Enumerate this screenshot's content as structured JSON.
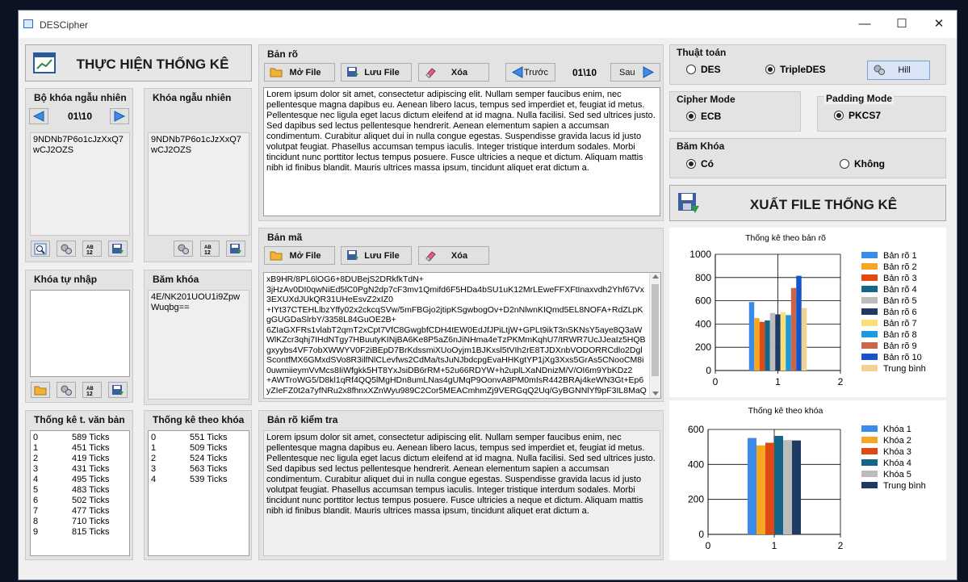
{
  "window": {
    "title": "DESCipher",
    "minimize": "—",
    "maximize": "☐",
    "close": "✕"
  },
  "stats_button": "THỰC HIỆN THỐNG KÊ",
  "random_key_set": {
    "title": "Bộ khóa ngẫu nhiên",
    "counter": "01\\10",
    "value": "9NDNb7P6o1cJzXxQ7wCJ2OZS"
  },
  "random_key": {
    "title": "Khóa ngẫu nhiên",
    "value": "9NDNb7P6o1cJzXxQ7wCJ2OZS"
  },
  "manual_key": {
    "title": "Khóa tự nhập",
    "value": ""
  },
  "hash_key": {
    "title": "Băm khóa",
    "value": "4E/NK201UOU1i9ZpwWuqbg=="
  },
  "plaintext": {
    "title": "Bản rõ",
    "open": "Mở File",
    "save": "Lưu File",
    "clear": "Xóa",
    "prev": "Trước",
    "counter": "01\\10",
    "next": "Sau",
    "text": "Lorem ipsum dolor sit amet, consectetur adipiscing elit. Nullam semper faucibus enim, nec pellentesque magna dapibus eu. Aenean libero lacus, tempus sed imperdiet et, feugiat id metus. Pellentesque nec ligula eget lacus dictum eleifend at id magna. Nulla facilisi. Sed sed ultrices justo. Sed dapibus sed lectus pellentesque hendrerit. Aenean elementum sapien a accumsan condimentum. Curabitur aliquet dui in nulla congue egestas. Suspendisse gravida lacus id justo volutpat feugiat. Phasellus accumsan tempus iaculis. Integer tristique interdum sodales. Morbi tincidunt nunc porttitor lectus tempus posuere. Fusce ultricies a neque et dictum. Aliquam mattis nibh id finibus blandit. Mauris ultrices massa ipsum, tincidunt aliquet erat dictum a."
  },
  "ciphertext": {
    "title": "Bản mã",
    "open": "Mở File",
    "save": "Lưu File",
    "clear": "Xóa",
    "text": "xB9HR/8PL6lOG6+8DUBejS2DRkfkTdN+\n3jHzAv0DI0qwNiEd5lC0PgN2dp7cF3mv1Qmifd6F5HDa4bSU1uK12MrLEweFFXFtInaxvdh2Yhf67Vx3EXUXdJUkQR31UHeEsvZ2xIZ0\n+IYt37CTEHLlbzYffy02x2ckcqSVw/5mFBGjo2jtipKSgwbogOv+D2nNlwnKIQmd5EL8NOFA+RdZLpKgGUGDaSlrbY/3358L84GuOE2B+\n6ZIaGXFRs1vlabT2qmT2xCpt7VfC8GwgbfCDH4tEW0EdJfJPiLtjW+GPLt9ikT3nSKNsY5aye8Q3aWWlKZcr3qhj7IHdNTgy7HBuutyKINjBA6Ke8P5aZ6nJiNHma4eTzPKMmKqhU7/tRWR7UcJJeaIz5HQBgxyybs4VF7obXWWYV0F2iBEpD7BrKdssmiXUoOyjm1BJKxsl5tVIh2rE8TJDXnbVODORRCdlo2DglScontfMX6GMxdSVo8R3ilfNlCLevfws2CdMa/tsJuNJbdcpgEvaHHKgtYP1jXg3Xxs5GrAs5CNooCM8i0uwmiieymVvMcs8IiWfgkk5HT8YxJsiDB6rRM+52u66RDYW+h2uplLXaNDnizM/V/OI6m9YbKDz2\n+AWTroWG5/D8kl1qRf4QQ5lMgHDn8umLNas4gUMqP9OonvA8PM0mIsR442BRAj4keWN3Gt+Ep6yZIeFZ0t2a7yfNRu2x8fhnxXZnWyu989C2Cor5MEACmhmZj9VERGqQ2Uq/GyBGNNlYf9pF3IL8MaQe"
  },
  "check_plaintext": {
    "title": "Bản rõ kiểm tra",
    "text": "Lorem ipsum dolor sit amet, consectetur adipiscing elit. Nullam semper faucibus enim, nec pellentesque magna dapibus eu. Aenean libero lacus, tempus sed imperdiet et, feugiat id metus. Pellentesque nec ligula eget lacus dictum eleifend at id magna. Nulla facilisi. Sed sed ultrices justo. Sed dapibus sed lectus pellentesque hendrerit. Aenean elementum sapien a accumsan condimentum. Curabitur aliquet dui in nulla congue egestas. Suspendisse gravida lacus id justo volutpat feugiat. Phasellus accumsan tempus iaculis. Integer tristique interdum sodales. Morbi tincidunt nunc porttitor lectus tempus posuere. Fusce ultricies a neque et dictum. Aliquam mattis nibh id finibus blandit. Mauris ultrices massa ipsum, tincidunt aliquet erat dictum a."
  },
  "text_stats": {
    "title": "Thống kê t. văn bản",
    "rows": [
      [
        "0",
        "589 Ticks"
      ],
      [
        "1",
        "451 Ticks"
      ],
      [
        "2",
        "419 Ticks"
      ],
      [
        "3",
        "431 Ticks"
      ],
      [
        "4",
        "495 Ticks"
      ],
      [
        "5",
        "483 Ticks"
      ],
      [
        "6",
        "502 Ticks"
      ],
      [
        "7",
        "477 Ticks"
      ],
      [
        "8",
        "710 Ticks"
      ],
      [
        "9",
        "815 Ticks"
      ]
    ]
  },
  "key_stats": {
    "title": "Thống kê theo khóa",
    "rows": [
      [
        "0",
        "551 Ticks"
      ],
      [
        "1",
        "509 Ticks"
      ],
      [
        "2",
        "524 Ticks"
      ],
      [
        "3",
        "563 Ticks"
      ],
      [
        "4",
        "539 Ticks"
      ]
    ]
  },
  "algorithm": {
    "title": "Thuật toán",
    "des": "DES",
    "triple": "TripleDES",
    "hill": "Hill",
    "selected": "TripleDES"
  },
  "cipher_mode": {
    "title": "Cipher Mode",
    "value": "ECB"
  },
  "padding_mode": {
    "title": "Padding Mode",
    "value": "PKCS7"
  },
  "hash": {
    "title": "Băm Khóa",
    "yes": "Có",
    "no": "Không",
    "selected": "Có"
  },
  "export_button": "XUẤT FILE THỐNG KÊ",
  "chart_data": [
    {
      "type": "bar",
      "title": "Thống kê theo bản rõ",
      "x_ticks": [
        "0",
        "1",
        "2"
      ],
      "y_ticks": [
        "0",
        "200",
        "400",
        "600",
        "800",
        "1000"
      ],
      "ylim": [
        0,
        1000
      ],
      "xlim": [
        0,
        2
      ],
      "series": [
        {
          "name": "Bản rõ 1",
          "values": [
            589
          ],
          "color": "#3b8be8"
        },
        {
          "name": "Bản rõ 2",
          "values": [
            451
          ],
          "color": "#f5a623"
        },
        {
          "name": "Bản rõ 3",
          "values": [
            419
          ],
          "color": "#e04a12"
        },
        {
          "name": "Bản rõ 4",
          "values": [
            431
          ],
          "color": "#14658a"
        },
        {
          "name": "Bản rõ 5",
          "values": [
            495
          ],
          "color": "#bcbcbc"
        },
        {
          "name": "Bản rõ 6",
          "values": [
            483
          ],
          "color": "#1f3b63"
        },
        {
          "name": "Bản rõ 7",
          "values": [
            502
          ],
          "color": "#f8df7a"
        },
        {
          "name": "Bản rõ 8",
          "values": [
            477
          ],
          "color": "#1a9be0"
        },
        {
          "name": "Bản rõ 9",
          "values": [
            710
          ],
          "color": "#c8674a"
        },
        {
          "name": "Bản rõ 10",
          "values": [
            815
          ],
          "color": "#1455cc"
        },
        {
          "name": "Trung bình",
          "values": [
            537
          ],
          "color": "#f2d290"
        }
      ]
    },
    {
      "type": "bar",
      "title": "Thống kê theo khóa",
      "x_ticks": [
        "0",
        "1",
        "2"
      ],
      "y_ticks": [
        "0",
        "200",
        "400",
        "600"
      ],
      "ylim": [
        0,
        600
      ],
      "xlim": [
        0,
        2
      ],
      "series": [
        {
          "name": "Khóa 1",
          "values": [
            551
          ],
          "color": "#3b8be8"
        },
        {
          "name": "Khóa 2",
          "values": [
            509
          ],
          "color": "#f5a623"
        },
        {
          "name": "Khóa 3",
          "values": [
            524
          ],
          "color": "#e04a12"
        },
        {
          "name": "Khóa 4",
          "values": [
            563
          ],
          "color": "#14658a"
        },
        {
          "name": "Khóa 5",
          "values": [
            539
          ],
          "color": "#bcbcbc"
        },
        {
          "name": "Trung bình",
          "values": [
            537
          ],
          "color": "#1f3b63"
        }
      ]
    }
  ]
}
